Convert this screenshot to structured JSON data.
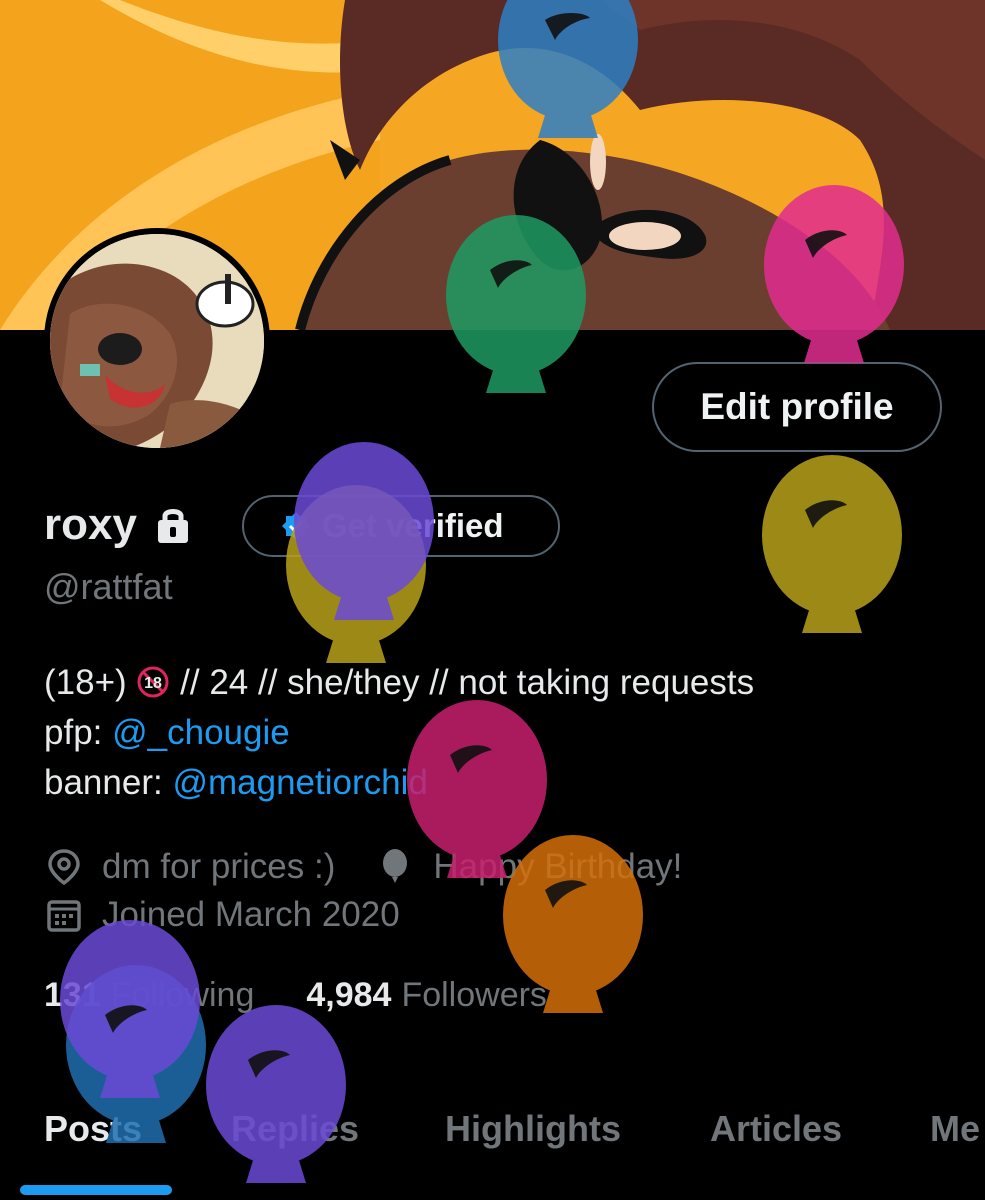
{
  "profile": {
    "display_name": "roxy",
    "handle": "@rattfat",
    "get_verified_label": "Get verified",
    "edit_profile_label": "Edit profile"
  },
  "bio": {
    "line1_prefix": "(18+)",
    "line1_badge": "18",
    "line1_suffix": "// 24 // she/they // not taking requests",
    "line2_label": "pfp:",
    "line2_link": "@_chougie",
    "line3_label": "banner:",
    "line3_link": "@magnetiorchid"
  },
  "meta": {
    "location": "dm for prices :)",
    "birthday": "Happy Birthday!",
    "joined": "Joined March 2020"
  },
  "stats": {
    "following_count": "131",
    "following_label": "Following",
    "followers_count": "4,984",
    "followers_label": "Followers"
  },
  "tabs": [
    {
      "label": "Posts",
      "active": true
    },
    {
      "label": "Replies",
      "active": false
    },
    {
      "label": "Highlights",
      "active": false
    },
    {
      "label": "Articles",
      "active": false
    },
    {
      "label": "Me",
      "active": false
    }
  ],
  "colors": {
    "accent": "#1d9bf0",
    "background": "#000000",
    "secondary_text": "#71767b",
    "balloon_blue": "#2e7fc4",
    "balloon_green": "#1e9a63",
    "balloon_pink": "#d42f8a",
    "balloon_yellow": "#b8a21a",
    "balloon_purple": "#6a4ad6",
    "balloon_magenta": "#c8206e",
    "balloon_orange": "#d4700a"
  },
  "icons": {
    "lock": "lock-icon",
    "verified": "verified-badge-icon",
    "location": "location-pin-icon",
    "birthday": "balloon-icon",
    "calendar": "calendar-icon"
  }
}
